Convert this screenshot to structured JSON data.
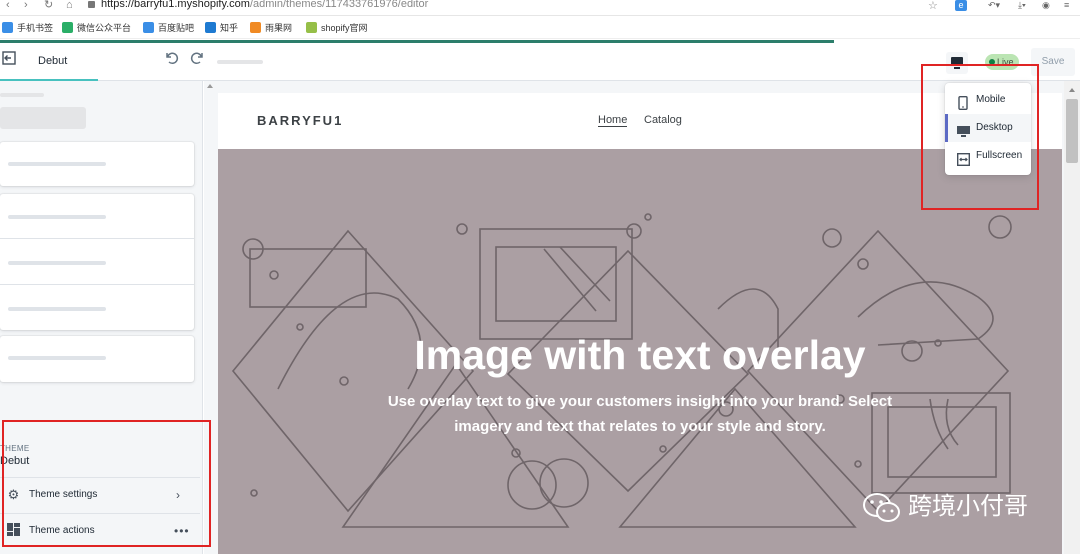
{
  "browser": {
    "url_host": "https://barryfu1.myshopify.com",
    "url_path": "/admin/themes/117433761976/editor",
    "bookmarks": [
      {
        "label": "手机书签",
        "color": "#3a8ee6"
      },
      {
        "label": "微信公众平台",
        "color": "#2aae67"
      },
      {
        "label": "百度贴吧",
        "color": "#3a8ee6"
      },
      {
        "label": "知乎",
        "color": "#1e7ad1"
      },
      {
        "label": "雨果网",
        "color": "#f08a24"
      },
      {
        "label": "shopify官网",
        "color": "#96bf48"
      }
    ]
  },
  "topbar": {
    "theme_name": "Debut",
    "live_label": "Live",
    "save_label": "Save"
  },
  "device_menu": {
    "items": [
      {
        "label": "Mobile",
        "icon": "mobile-icon",
        "selected": false
      },
      {
        "label": "Desktop",
        "icon": "desktop-icon",
        "selected": true
      },
      {
        "label": "Fullscreen",
        "icon": "fullscreen-icon",
        "selected": false
      }
    ]
  },
  "sidebar": {
    "theme_caption": "THEME",
    "theme_value": "Debut",
    "rows": [
      {
        "label": "Theme settings",
        "icon": "gear-icon"
      },
      {
        "label": "Theme actions",
        "icon": "layout-icon"
      }
    ]
  },
  "store": {
    "logo": "BARRYFU1",
    "nav": [
      "Home",
      "Catalog"
    ],
    "hero_title": "Image with text overlay",
    "hero_text": "Use overlay text to give your customers insight into your brand. Select imagery and text that relates to your style and story."
  },
  "watermark": "跨境小付哥",
  "colors": {
    "accent": "#5c6ac4",
    "annotation": "#e02424",
    "hero_bg": "#ab9fa3",
    "live_bg": "#bbe5b3"
  }
}
